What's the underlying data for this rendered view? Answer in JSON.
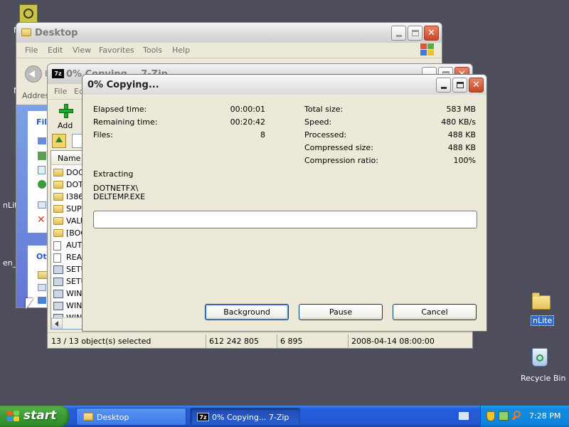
{
  "desktop": {
    "icons": [
      {
        "label": "nLite"
      },
      {
        "label": "Recycle Bin"
      }
    ],
    "clipped_labels": [
      "M",
      "N",
      "nLit",
      "en_"
    ]
  },
  "explorer": {
    "title": "Desktop",
    "menu": [
      "File",
      "Edit",
      "View",
      "Favorites",
      "Tools",
      "Help"
    ],
    "address_label": "Addres",
    "back_label": "B",
    "panel_titles": [
      "File",
      "Oth"
    ]
  },
  "sevenzip_main": {
    "title": "0% Copying... 7-Zip",
    "menu": [
      "File",
      "Ed"
    ],
    "toolbar": {
      "add_label": "Add"
    },
    "column_name": "Name",
    "files": [
      {
        "name": "DOC",
        "kind": "folder"
      },
      {
        "name": "DOT",
        "kind": "folder"
      },
      {
        "name": "I386",
        "kind": "folder"
      },
      {
        "name": "SUPI",
        "kind": "folder"
      },
      {
        "name": "VALU",
        "kind": "folder"
      },
      {
        "name": "[BOO",
        "kind": "folder"
      },
      {
        "name": "AUT",
        "kind": "file"
      },
      {
        "name": "REA",
        "kind": "file"
      },
      {
        "name": "SETU",
        "kind": "exe"
      },
      {
        "name": "SETU",
        "kind": "exe"
      },
      {
        "name": "WIN",
        "kind": "exe"
      },
      {
        "name": "WIN",
        "kind": "exe"
      },
      {
        "name": "WIN",
        "kind": "exe"
      }
    ],
    "status": {
      "selected": "13 / 13 object(s) selected",
      "size": "612 242 805",
      "packed": "6 895",
      "modified": "2008-04-14 08:00:00"
    }
  },
  "progress_dialog": {
    "title": "0% Copying...",
    "left_stats": [
      {
        "label": "Elapsed time:",
        "value": "00:00:01"
      },
      {
        "label": "Remaining time:",
        "value": "00:20:42"
      },
      {
        "label": "Files:",
        "value": "8"
      }
    ],
    "right_stats": [
      {
        "label": "Total size:",
        "value": "583 MB"
      },
      {
        "label": "Speed:",
        "value": "480 KB/s"
      },
      {
        "label": "Processed:",
        "value": "488 KB"
      },
      {
        "label": "Compressed size:",
        "value": "488 KB"
      },
      {
        "label": "Compression ratio:",
        "value": "100%"
      }
    ],
    "operation": "Extracting",
    "current_path": "DOTNETFX\\",
    "current_file": "DELTEMP.EXE",
    "progress_fraction": 0,
    "buttons": {
      "background": "Background",
      "pause": "Pause",
      "cancel": "Cancel"
    }
  },
  "taskbar": {
    "start_label": "start",
    "tasks": [
      {
        "label": "Desktop",
        "pressed": false
      },
      {
        "label": "0% Copying... 7-Zip",
        "pressed": true
      }
    ],
    "clock": "7:28 PM"
  },
  "colors": {
    "desktop": "#4d4d5b",
    "taskbar": "#245edc",
    "start": "#3c9a35",
    "dialog_face": "#ece9d8"
  }
}
